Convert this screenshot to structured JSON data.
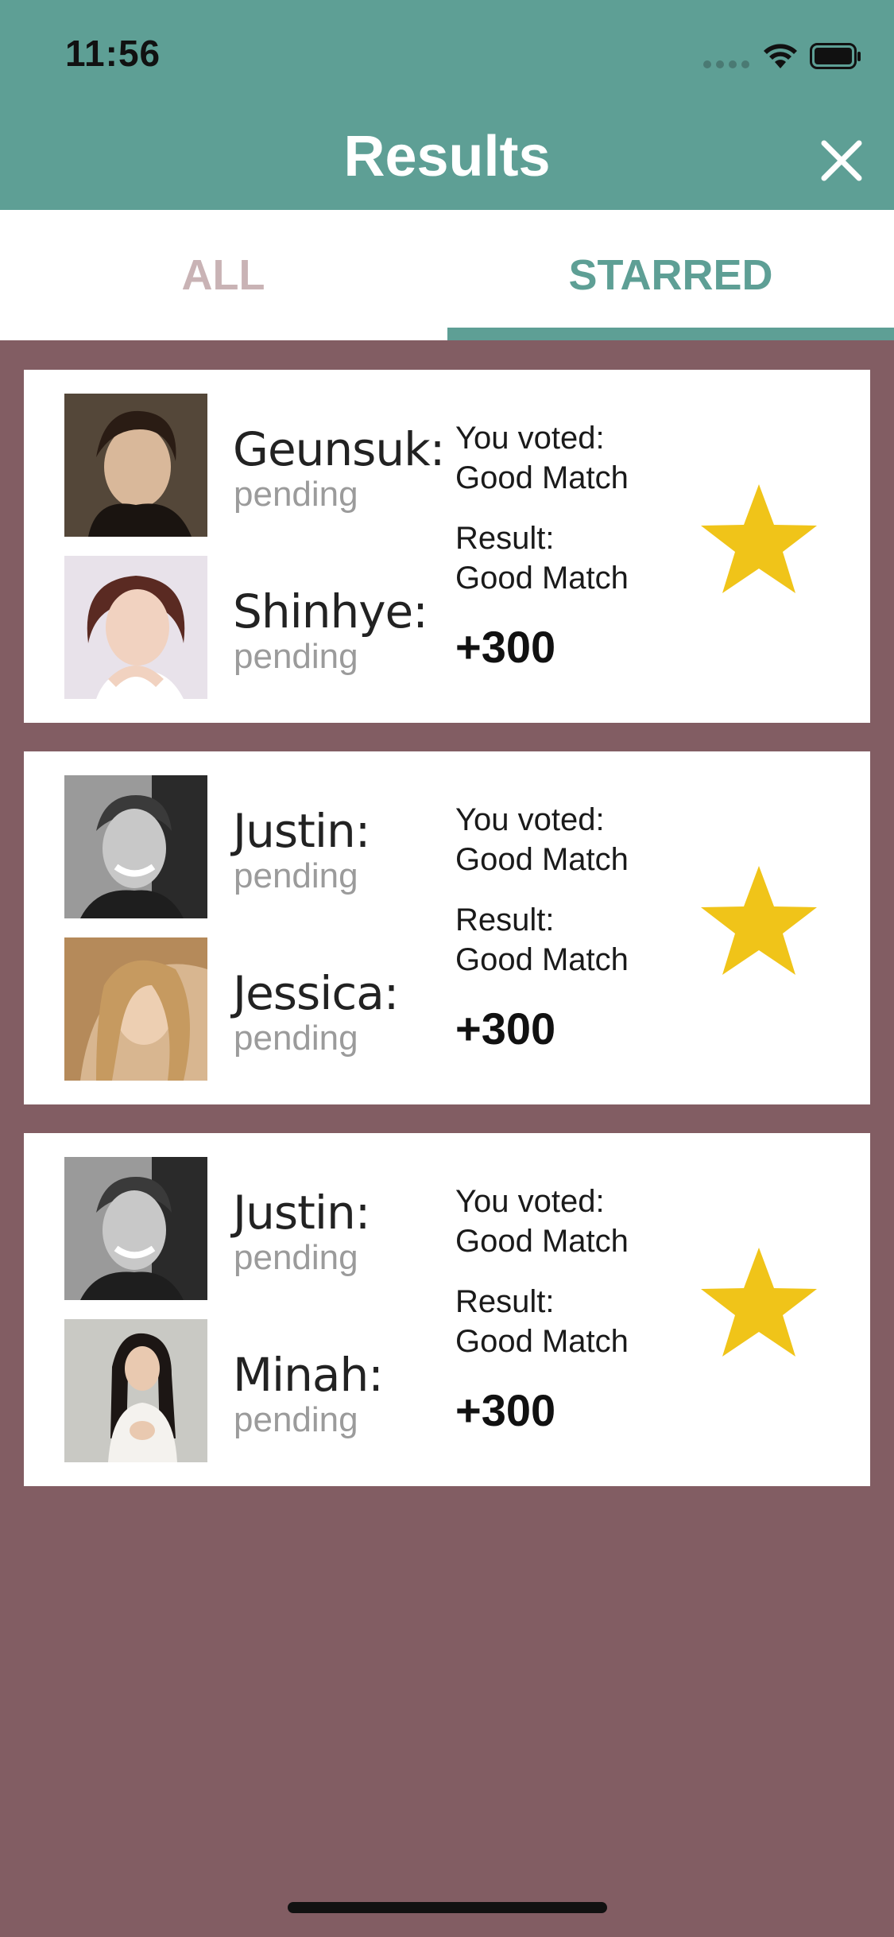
{
  "status_bar": {
    "time": "11:56"
  },
  "header": {
    "title": "Results",
    "close_icon": "close-icon",
    "background": "#5e9f95"
  },
  "tabs": [
    {
      "label": "ALL",
      "active": false
    },
    {
      "label": "STARRED",
      "active": true
    }
  ],
  "colors": {
    "accent": "#5e9f95",
    "page_background": "#825d63",
    "star": "#f0c419",
    "inactive_tab": "#c9b3b5"
  },
  "results": [
    {
      "person1": {
        "name": "Geunsuk:",
        "status": "pending"
      },
      "person2": {
        "name": "Shinhye:",
        "status": "pending"
      },
      "voted_label": "You voted:",
      "voted_value": "Good Match",
      "result_label": "Result:",
      "result_value": "Good Match",
      "points": "+300",
      "starred": true
    },
    {
      "person1": {
        "name": "Justin:",
        "status": "pending"
      },
      "person2": {
        "name": "Jessica:",
        "status": "pending"
      },
      "voted_label": "You voted:",
      "voted_value": "Good Match",
      "result_label": "Result:",
      "result_value": "Good Match",
      "points": "+300",
      "starred": true
    },
    {
      "person1": {
        "name": "Justin:",
        "status": "pending"
      },
      "person2": {
        "name": "Minah:",
        "status": "pending"
      },
      "voted_label": "You voted:",
      "voted_value": "Good Match",
      "result_label": "Result:",
      "result_value": "Good Match",
      "points": "+300",
      "starred": true
    }
  ]
}
